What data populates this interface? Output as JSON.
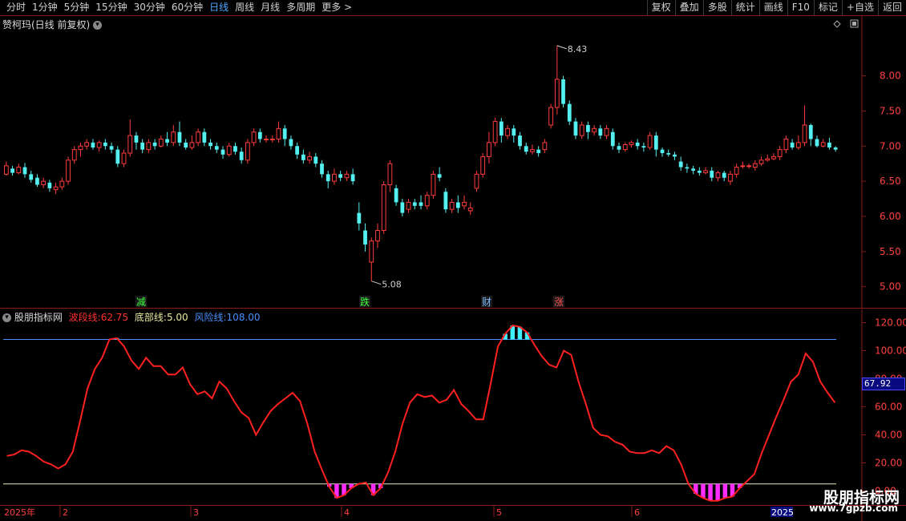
{
  "toolbar": {
    "left": [
      "分时",
      "1分钟",
      "5分钟",
      "15分钟",
      "30分钟",
      "60分钟",
      "日线",
      "周线",
      "月线",
      "多周期",
      "更多 >"
    ],
    "active": "日线",
    "right": [
      "复权",
      "叠加",
      "多股",
      "统计",
      "画线",
      "F10",
      "标记",
      "+自选",
      "返回"
    ]
  },
  "main": {
    "title": "赞柯玛(日线 前复权)",
    "max_label": "8.43",
    "min_label": "5.08",
    "y_ticks": [
      "8.00",
      "7.50",
      "7.00",
      "6.50",
      "6.00",
      "5.50",
      "5.00"
    ],
    "y_values": [
      8.0,
      7.5,
      7.0,
      6.5,
      6.0,
      5.5,
      5.0
    ],
    "events": [
      {
        "label": "减",
        "color": "#3cff3c"
      },
      {
        "label": "跌",
        "color": "#3cff3c"
      },
      {
        "label": "财",
        "color": "#7fb8ff"
      },
      {
        "label": "涨",
        "color": "#ff5050"
      }
    ]
  },
  "indicator": {
    "name": "股朋指标网",
    "wave_label": "波段线:",
    "wave_value": "62.75",
    "bottom_label": "底部线:",
    "bottom_value": "5.00",
    "risk_label": "风险线:",
    "risk_value": "108.00",
    "y_ticks": [
      "120.00",
      "100.00",
      "80.00",
      "60.00",
      "40.00",
      "20.00",
      "0.00"
    ],
    "y_values": [
      120,
      100,
      80,
      60,
      40,
      20,
      0
    ],
    "cursor_value": "67.92"
  },
  "xaxis": {
    "labels": [
      "2025年",
      "2",
      "3",
      "4",
      "5",
      "6",
      "2025"
    ]
  },
  "watermark": {
    "name": "股朋指标网",
    "url": "www.7gpzb.com"
  },
  "colors": {
    "up": "#ff3c3c",
    "down": "#54f0f0",
    "wave": "#ff2020",
    "risk": "#4a8fff",
    "bottom": "#e8e8c0",
    "magenta": "#ff2cff",
    "cyan": "#40f0ff",
    "axis": "#8a1c1c"
  },
  "chart_data": [
    {
      "type": "candlestick",
      "title": "赞柯玛(日线 前复权)",
      "ylim": [
        4.7,
        8.85
      ],
      "annotations": [
        {
          "label": "8.43",
          "value": 8.43
        },
        {
          "label": "5.08",
          "value": 5.08
        }
      ],
      "candles": [
        [
          6.6,
          6.72,
          6.58,
          6.78
        ],
        [
          6.68,
          6.62,
          6.58,
          6.72
        ],
        [
          6.62,
          6.7,
          6.6,
          6.75
        ],
        [
          6.7,
          6.6,
          6.55,
          6.76
        ],
        [
          6.6,
          6.52,
          6.48,
          6.65
        ],
        [
          6.55,
          6.45,
          6.42,
          6.6
        ],
        [
          6.45,
          6.5,
          6.4,
          6.55
        ],
        [
          6.48,
          6.4,
          6.35,
          6.52
        ],
        [
          6.38,
          6.42,
          6.32,
          6.48
        ],
        [
          6.42,
          6.5,
          6.38,
          6.55
        ],
        [
          6.5,
          6.8,
          6.45,
          6.85
        ],
        [
          6.8,
          6.95,
          6.75,
          7.0
        ],
        [
          6.95,
          7.0,
          6.85,
          7.05
        ],
        [
          7.0,
          7.05,
          6.95,
          7.1
        ],
        [
          7.05,
          6.98,
          6.95,
          7.1
        ],
        [
          6.98,
          7.05,
          6.92,
          7.08
        ],
        [
          7.05,
          7.0,
          6.95,
          7.1
        ],
        [
          7.0,
          6.95,
          6.9,
          7.05
        ],
        [
          6.95,
          6.75,
          6.7,
          7.0
        ],
        [
          6.75,
          6.9,
          6.7,
          6.95
        ],
        [
          6.9,
          7.15,
          6.85,
          7.38
        ],
        [
          7.15,
          7.05,
          6.95,
          7.2
        ],
        [
          7.05,
          6.95,
          6.9,
          7.1
        ],
        [
          6.95,
          7.05,
          6.9,
          7.1
        ],
        [
          7.05,
          7.0,
          6.95,
          7.1
        ],
        [
          7.0,
          7.1,
          6.98,
          7.15
        ],
        [
          7.1,
          7.05,
          7.0,
          7.2
        ],
        [
          7.05,
          7.2,
          7.0,
          7.3
        ],
        [
          7.2,
          7.05,
          7.0,
          7.35
        ],
        [
          7.05,
          6.98,
          6.95,
          7.1
        ],
        [
          6.98,
          7.05,
          6.95,
          7.15
        ],
        [
          7.05,
          7.2,
          7.0,
          7.25
        ],
        [
          7.2,
          7.05,
          7.0,
          7.25
        ],
        [
          7.05,
          7.0,
          6.95,
          7.1
        ],
        [
          7.0,
          6.95,
          6.9,
          7.05
        ],
        [
          6.95,
          6.88,
          6.82,
          7.0
        ],
        [
          6.88,
          7.0,
          6.85,
          7.05
        ],
        [
          7.0,
          6.92,
          6.88,
          7.05
        ],
        [
          6.92,
          6.8,
          6.75,
          6.98
        ],
        [
          6.8,
          7.05,
          6.75,
          7.1
        ],
        [
          7.05,
          7.2,
          7.0,
          7.25
        ],
        [
          7.2,
          7.1,
          7.05,
          7.25
        ],
        [
          7.1,
          7.1,
          7.05,
          7.15
        ],
        [
          7.1,
          7.1,
          7.05,
          7.15
        ],
        [
          7.1,
          7.25,
          7.05,
          7.35
        ],
        [
          7.25,
          7.1,
          7.0,
          7.3
        ],
        [
          7.1,
          7.0,
          6.95,
          7.15
        ],
        [
          7.0,
          6.88,
          6.82,
          7.05
        ],
        [
          6.88,
          6.8,
          6.75,
          6.95
        ],
        [
          6.8,
          6.85,
          6.75,
          6.92
        ],
        [
          6.85,
          6.75,
          6.7,
          6.9
        ],
        [
          6.75,
          6.6,
          6.55,
          6.8
        ],
        [
          6.6,
          6.5,
          6.4,
          6.65
        ],
        [
          6.5,
          6.6,
          6.45,
          6.68
        ],
        [
          6.6,
          6.55,
          6.5,
          6.65
        ],
        [
          6.55,
          6.6,
          6.5,
          6.65
        ],
        [
          6.6,
          6.5,
          6.45,
          6.68
        ],
        [
          6.05,
          5.9,
          5.8,
          6.2
        ],
        [
          5.8,
          5.6,
          5.5,
          5.9
        ],
        [
          5.35,
          5.65,
          5.08,
          5.7
        ],
        [
          5.65,
          5.8,
          5.55,
          5.9
        ],
        [
          5.8,
          6.45,
          5.75,
          6.5
        ],
        [
          6.45,
          6.75,
          6.35,
          6.8
        ],
        [
          6.4,
          6.2,
          6.15,
          6.45
        ],
        [
          6.2,
          6.05,
          6.0,
          6.25
        ],
        [
          6.1,
          6.2,
          6.05,
          6.25
        ],
        [
          6.2,
          6.15,
          6.1,
          6.25
        ],
        [
          6.2,
          6.15,
          6.1,
          6.3
        ],
        [
          6.15,
          6.3,
          6.1,
          6.35
        ],
        [
          6.3,
          6.6,
          6.25,
          6.65
        ],
        [
          6.6,
          6.55,
          6.5,
          6.7
        ],
        [
          6.35,
          6.1,
          6.05,
          6.4
        ],
        [
          6.1,
          6.2,
          6.05,
          6.25
        ],
        [
          6.2,
          6.12,
          6.05,
          6.3
        ],
        [
          6.15,
          6.2,
          6.1,
          6.3
        ],
        [
          6.08,
          6.12,
          6.02,
          6.2
        ],
        [
          6.4,
          6.6,
          6.35,
          6.65
        ],
        [
          6.6,
          6.85,
          6.55,
          6.9
        ],
        [
          6.85,
          7.05,
          6.75,
          7.2
        ],
        [
          7.05,
          7.35,
          7.0,
          7.4
        ],
        [
          7.35,
          7.15,
          7.05,
          7.4
        ],
        [
          7.15,
          7.25,
          7.1,
          7.3
        ],
        [
          7.25,
          7.15,
          7.05,
          7.3
        ],
        [
          7.15,
          7.0,
          6.95,
          7.2
        ],
        [
          7.0,
          6.92,
          6.88,
          7.05
        ],
        [
          6.92,
          6.95,
          6.88,
          7.02
        ],
        [
          6.95,
          6.9,
          6.85,
          7.0
        ],
        [
          6.95,
          7.05,
          6.9,
          7.1
        ],
        [
          7.3,
          7.55,
          7.25,
          7.6
        ],
        [
          7.55,
          7.95,
          7.45,
          8.43
        ],
        [
          7.95,
          7.6,
          7.55,
          8.0
        ],
        [
          7.6,
          7.35,
          7.3,
          7.65
        ],
        [
          7.35,
          7.15,
          7.1,
          7.4
        ],
        [
          7.15,
          7.3,
          7.1,
          7.35
        ],
        [
          7.3,
          7.2,
          7.1,
          7.35
        ],
        [
          7.2,
          7.25,
          7.15,
          7.3
        ],
        [
          7.25,
          7.15,
          7.1,
          7.3
        ],
        [
          7.15,
          7.25,
          7.1,
          7.3
        ],
        [
          7.2,
          7.0,
          6.95,
          7.25
        ],
        [
          7.0,
          6.95,
          6.9,
          7.05
        ],
        [
          6.95,
          7.02,
          6.92,
          7.05
        ],
        [
          7.02,
          7.05,
          6.98,
          7.08
        ],
        [
          7.05,
          7.0,
          6.95,
          7.1
        ],
        [
          7.0,
          6.98,
          6.92,
          7.05
        ],
        [
          6.98,
          7.15,
          6.95,
          7.2
        ],
        [
          7.15,
          6.95,
          6.85,
          7.2
        ],
        [
          6.95,
          6.9,
          6.85,
          6.98
        ],
        [
          6.9,
          6.88,
          6.85,
          6.95
        ],
        [
          6.88,
          6.85,
          6.8,
          6.92
        ],
        [
          6.78,
          6.7,
          6.65,
          6.85
        ],
        [
          6.7,
          6.68,
          6.62,
          6.75
        ],
        [
          6.68,
          6.65,
          6.6,
          6.72
        ],
        [
          6.65,
          6.62,
          6.58,
          6.7
        ],
        [
          6.62,
          6.65,
          6.6,
          6.7
        ],
        [
          6.65,
          6.55,
          6.5,
          6.7
        ],
        [
          6.55,
          6.62,
          6.5,
          6.65
        ],
        [
          6.62,
          6.55,
          6.5,
          6.65
        ],
        [
          6.5,
          6.6,
          6.45,
          6.65
        ],
        [
          6.6,
          6.7,
          6.55,
          6.75
        ],
        [
          6.72,
          6.72,
          6.68,
          6.78
        ],
        [
          6.72,
          6.72,
          6.68,
          6.75
        ],
        [
          6.7,
          6.75,
          6.65,
          6.8
        ],
        [
          6.75,
          6.8,
          6.72,
          6.85
        ],
        [
          6.8,
          6.82,
          6.78,
          6.88
        ],
        [
          6.82,
          6.85,
          6.8,
          6.9
        ],
        [
          6.85,
          6.95,
          6.8,
          7.0
        ],
        [
          6.95,
          7.1,
          6.9,
          7.15
        ],
        [
          7.05,
          6.98,
          6.95,
          7.1
        ],
        [
          6.98,
          7.05,
          6.95,
          7.15
        ],
        [
          7.05,
          7.3,
          7.0,
          7.58
        ],
        [
          7.3,
          7.1,
          7.0,
          7.32
        ],
        [
          7.1,
          7.0,
          6.98,
          7.15
        ],
        [
          7.0,
          7.05,
          6.98,
          7.1
        ],
        [
          7.05,
          6.98,
          6.95,
          7.12
        ],
        [
          6.98,
          6.95,
          6.92,
          7.0
        ]
      ]
    },
    {
      "type": "line",
      "title": "股朋指标网",
      "ylim": [
        -10,
        130
      ],
      "series": [
        {
          "name": "波段线",
          "values": [
            25,
            26,
            29,
            28,
            25,
            21,
            19,
            16,
            19,
            28,
            50,
            73,
            87,
            95,
            108,
            109,
            103,
            93,
            87,
            95,
            89,
            89,
            83,
            83,
            88,
            76,
            69,
            71,
            66,
            78,
            73,
            64,
            56,
            52,
            40,
            49,
            57,
            62,
            66,
            70,
            64,
            48,
            28,
            15,
            3,
            -5,
            -3,
            2,
            5,
            6,
            -3,
            2,
            13,
            28,
            48,
            63,
            69,
            67,
            68,
            63,
            65,
            72,
            62,
            57,
            51,
            51,
            76,
            103,
            112,
            118,
            117,
            113,
            104,
            96,
            90,
            88,
            100,
            97,
            78,
            62,
            45,
            40,
            39,
            35,
            33,
            28,
            27,
            27,
            29,
            27,
            32,
            29,
            19,
            5,
            -2,
            -5,
            -7,
            -7,
            -5,
            -4,
            2,
            7,
            12,
            27,
            40,
            53,
            65,
            78,
            83,
            98,
            92,
            78,
            70,
            63
          ]
        },
        {
          "name": "风险线",
          "values": [
            108
          ]
        },
        {
          "name": "底部线",
          "values": [
            5
          ]
        }
      ]
    }
  ]
}
